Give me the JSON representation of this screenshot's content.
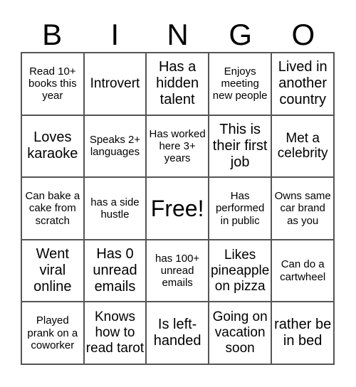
{
  "header": [
    "B",
    "I",
    "N",
    "G",
    "O"
  ],
  "cells": [
    [
      "Read 10+ books this year",
      "Introvert",
      "Has a hidden talent",
      "Enjoys meeting new people",
      "Lived in another country"
    ],
    [
      "Loves karaoke",
      "Speaks 2+ languages",
      "Has worked here 3+ years",
      "This is their first job",
      "Met a celebrity"
    ],
    [
      "Can bake a cake from scratch",
      "has a side hustle",
      "Free!",
      "Has performed in public",
      "Owns same car brand as you"
    ],
    [
      "Went viral online",
      "Has 0 unread emails",
      "has 100+ unread emails",
      "Likes pineapple on pizza",
      "Can do a cartwheel"
    ],
    [
      "Played prank on a coworker",
      "Knows how to read tarot",
      "Is left-handed",
      "Going on vacation soon",
      "rather be in bed"
    ]
  ]
}
